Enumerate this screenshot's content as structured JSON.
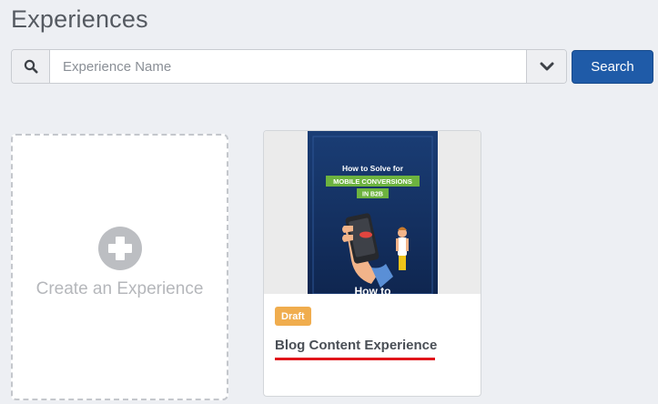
{
  "page": {
    "title": "Experiences"
  },
  "search": {
    "icon": "search-icon",
    "placeholder": "Experience Name",
    "value": "",
    "dropdown_icon": "chevron-down-icon",
    "button_label": "Search",
    "button_color": "#1f5ba8"
  },
  "create_card": {
    "icon": "plus-circle-icon",
    "label": "Create an Experience"
  },
  "experiences": [
    {
      "thumbnail": {
        "line1": "How to Solve for",
        "line2": "MOBILE CONVERSIONS",
        "line3": "IN B2B",
        "footer": "How to"
      },
      "status": "Draft",
      "status_color": "#f0ad4e",
      "title": "Blog Content Experience",
      "underline_color": "#e0151b"
    }
  ]
}
